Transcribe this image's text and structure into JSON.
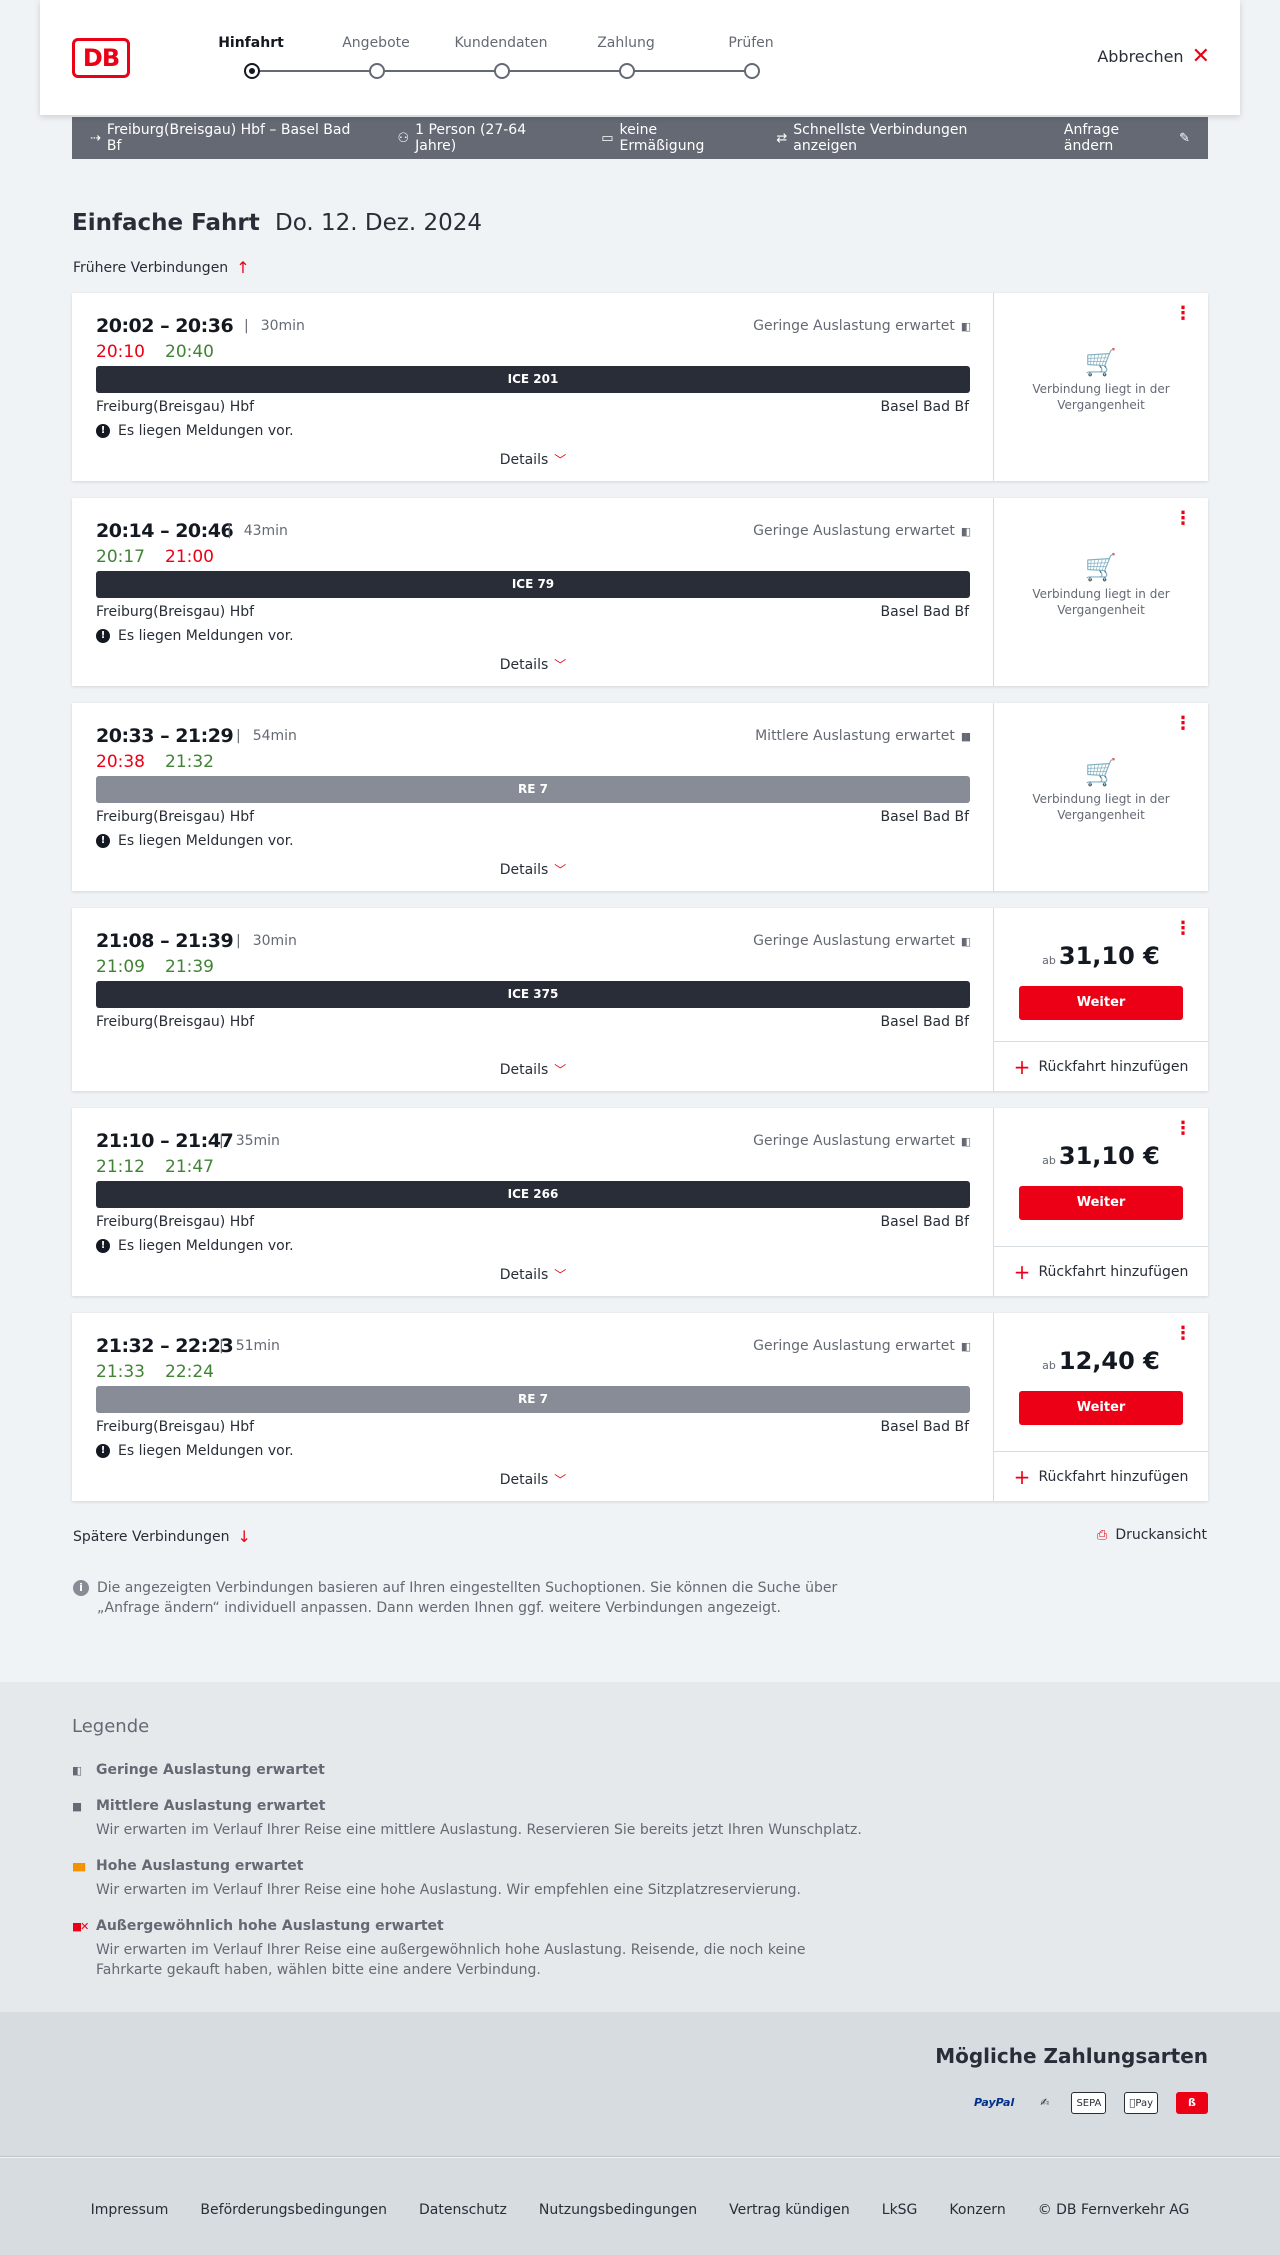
{
  "header": {
    "logo": "DB",
    "steps": [
      "Hinfahrt",
      "Angebote",
      "Kundendaten",
      "Zahlung",
      "Prüfen"
    ],
    "cancel_label": "Abbrechen"
  },
  "searchbar": {
    "route": "Freiburg(Breisgau) Hbf – Basel Bad Bf",
    "passengers": "1 Person (27-64 Jahre)",
    "discount": "keine Ermäßigung",
    "option": "Schnellste Verbindungen anzeigen",
    "edit": "Anfrage ändern"
  },
  "title": {
    "type": "Einfache Fahrt",
    "date": "Do. 12. Dez. 2024"
  },
  "earlier_label": "Frühere Verbindungen",
  "later_label": "Spätere Verbindungen",
  "print_label": "Druckansicht",
  "details_label": "Details",
  "past_label": "Verbindung liegt in der Vergangenheit",
  "price_prefix": "ab",
  "continue_label": "Weiter",
  "return_label": "Rückfahrt hinzufügen",
  "connections": [
    {
      "times": "20:02 – 20:36",
      "duration": "30min",
      "occupancy": "Geringe Auslastung erwartet",
      "rt_dep": "20:10",
      "rt_dep_color": "red",
      "rt_arr": "20:40",
      "rt_arr_color": "green",
      "train": "ICE 201",
      "train_type": "ice",
      "from": "Freiburg(Breisgau) Hbf",
      "to": "Basel Bad Bf",
      "message": "Es liegen Meldungen vor.",
      "status": "past"
    },
    {
      "times": "20:14 – 20:46",
      "duration": "43min",
      "occupancy": "Geringe Auslastung erwartet",
      "rt_dep": "20:17",
      "rt_dep_color": "green",
      "rt_arr": "21:00",
      "rt_arr_color": "red",
      "train": "ICE 79",
      "train_type": "ice",
      "from": "Freiburg(Breisgau) Hbf",
      "to": "Basel Bad Bf",
      "message": "Es liegen Meldungen vor.",
      "status": "past"
    },
    {
      "times": "20:33 – 21:29",
      "duration": "54min",
      "occupancy": "Mittlere Auslastung erwartet",
      "rt_dep": "20:38",
      "rt_dep_color": "red",
      "rt_arr": "21:32",
      "rt_arr_color": "green",
      "train": "RE 7",
      "train_type": "re",
      "from": "Freiburg(Breisgau) Hbf",
      "to": "Basel Bad Bf",
      "message": "Es liegen Meldungen vor.",
      "status": "past"
    },
    {
      "times": "21:08 – 21:39",
      "duration": "30min",
      "occupancy": "Geringe Auslastung erwartet",
      "rt_dep": "21:09",
      "rt_dep_color": "green",
      "rt_arr": "21:39",
      "rt_arr_color": "green",
      "train": "ICE 375",
      "train_type": "ice",
      "from": "Freiburg(Breisgau) Hbf",
      "to": "Basel Bad Bf",
      "message": "",
      "status": "price",
      "price": "31,10 €"
    },
    {
      "times": "21:10 – 21:47",
      "duration": "35min",
      "occupancy": "Geringe Auslastung erwartet",
      "rt_dep": "21:12",
      "rt_dep_color": "green",
      "rt_arr": "21:47",
      "rt_arr_color": "green",
      "train": "ICE 266",
      "train_type": "ice",
      "from": "Freiburg(Breisgau) Hbf",
      "to": "Basel Bad Bf",
      "message": "Es liegen Meldungen vor.",
      "status": "price",
      "price": "31,10 €"
    },
    {
      "times": "21:32 – 22:23",
      "duration": "51min",
      "occupancy": "Geringe Auslastung erwartet",
      "rt_dep": "21:33",
      "rt_dep_color": "green",
      "rt_arr": "22:24",
      "rt_arr_color": "green",
      "train": "RE 7",
      "train_type": "re",
      "from": "Freiburg(Breisgau) Hbf",
      "to": "Basel Bad Bf",
      "message": "Es liegen Meldungen vor.",
      "status": "price",
      "price": "12,40 €"
    }
  ],
  "info_text": "Die angezeigten Verbindungen basieren auf Ihren eingestellten Suchoptionen. Sie können die Suche über „Anfrage ändern“ individuell anpassen. Dann werden Ihnen ggf. weitere Verbindungen angezeigt.",
  "legend": {
    "title": "Legende",
    "items": [
      {
        "title": "Geringe Auslastung erwartet",
        "desc": "",
        "level": "low"
      },
      {
        "title": "Mittlere Auslastung erwartet",
        "desc": "Wir erwarten im Verlauf Ihrer Reise eine mittlere Auslastung. Reservieren Sie bereits jetzt Ihren Wunschplatz.",
        "level": "mid"
      },
      {
        "title": "Hohe Auslastung erwartet",
        "desc": "Wir erwarten im Verlauf Ihrer Reise eine hohe Auslastung. Wir empfehlen eine Sitzplatzreservierung.",
        "level": "high"
      },
      {
        "title": "Außergewöhnlich hohe Auslastung erwartet",
        "desc": "Wir erwarten im Verlauf Ihrer Reise eine außergewöhnlich hohe Auslastung. Reisende, die noch keine Fahrkarte gekauft haben, wählen bitte eine andere Verbindung.",
        "level": "ext"
      }
    ]
  },
  "payment": {
    "title": "Mögliche Zahlungsarten",
    "methods": [
      "PayPal",
      "SEPA",
      "Pay"
    ]
  },
  "footer": {
    "links": [
      "Impressum",
      "Beförderungsbedingungen",
      "Datenschutz",
      "Nutzungsbedingungen",
      "Vertrag kündigen",
      "LkSG",
      "Konzern"
    ],
    "copyright": "© DB Fernverkehr AG"
  },
  "colors": {
    "brand_red": "#ec0016",
    "delay_red": "#ec0016",
    "ontime_green": "#408335",
    "train_dark": "#282d37",
    "train_regional": "#878c96"
  }
}
